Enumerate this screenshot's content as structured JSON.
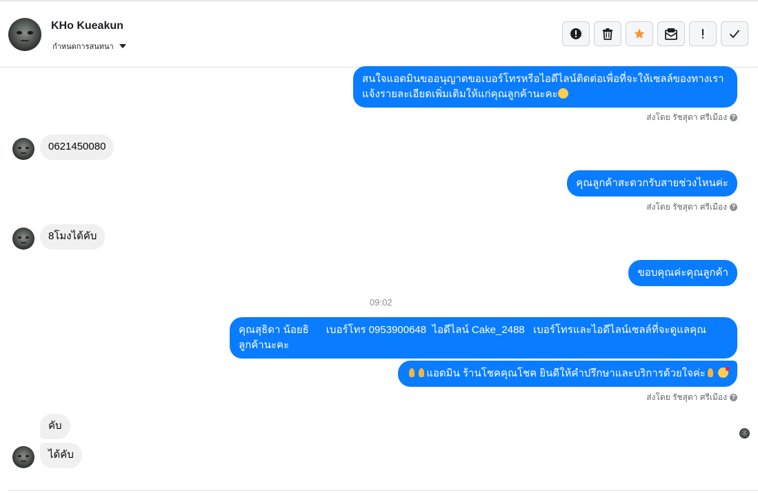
{
  "header": {
    "name": "KHo Kueakun",
    "subtitle": "กำหนดการสนทนา",
    "toolbar": [
      {
        "icon": "alert-circle-icon",
        "name": "alert-button"
      },
      {
        "icon": "trash-icon",
        "name": "delete-button"
      },
      {
        "icon": "star-icon",
        "name": "star-button"
      },
      {
        "icon": "mail-icon",
        "name": "mark-unread-button"
      },
      {
        "icon": "exclamation-icon",
        "name": "spam-button"
      },
      {
        "icon": "check-icon",
        "name": "done-button"
      }
    ]
  },
  "colors": {
    "outgoing_bubble": "#0a7cff",
    "incoming_bubble": "#f0f0f0",
    "star": "#f7923a"
  },
  "messages": {
    "m1_line1": "สนใจแอดมินขออนุญาตขอเบอร์โทรหรือไอดีไลน์ติดต่อเพื่อที่จะให้เซลล์ของทางเรา",
    "m1_line2": "แจ้งรายละเอียดเพิ่มเติมให้แก่คุณลูกค้านะคะ",
    "m1_emoji": "smile-emoji",
    "sent_by_1": "ส่งโดย รัชสุดา ศรีเมือง",
    "m2": "0621450080",
    "m3": "คุณลูกค้าสะดวกรับสายช่วงไหนค่ะ",
    "sent_by_2": "ส่งโดย รัชสุดา ศรีเมือง",
    "m4": "8โมงได้คับ",
    "m5": "ขอบคุณค่ะคุณลูกค้า",
    "time": "09:02",
    "m6_line1": "คุณสุธิดา น้อยธิ      เบอร์โทร 0953900648  ไอดีไลน์ Cake_2488   เบอร์โทรและไอดีไลน์เซลล์ที่จะดูแลคุณ",
    "m6_line2": "ลูกค้านะคะ",
    "m7": "แอดมิน ร้านโชคคุณโชค ยินดีให้คำปรึกษาและบริการด้วยใจค่ะ",
    "m7_emojis": [
      "pray-emoji",
      "pray-emoji",
      "pray-emoji",
      "heart-face-emoji"
    ],
    "sent_by_3": "ส่งโดย รัชสุดา ศรีเมือง",
    "m8": "คับ",
    "m9": "ได้คับ"
  }
}
